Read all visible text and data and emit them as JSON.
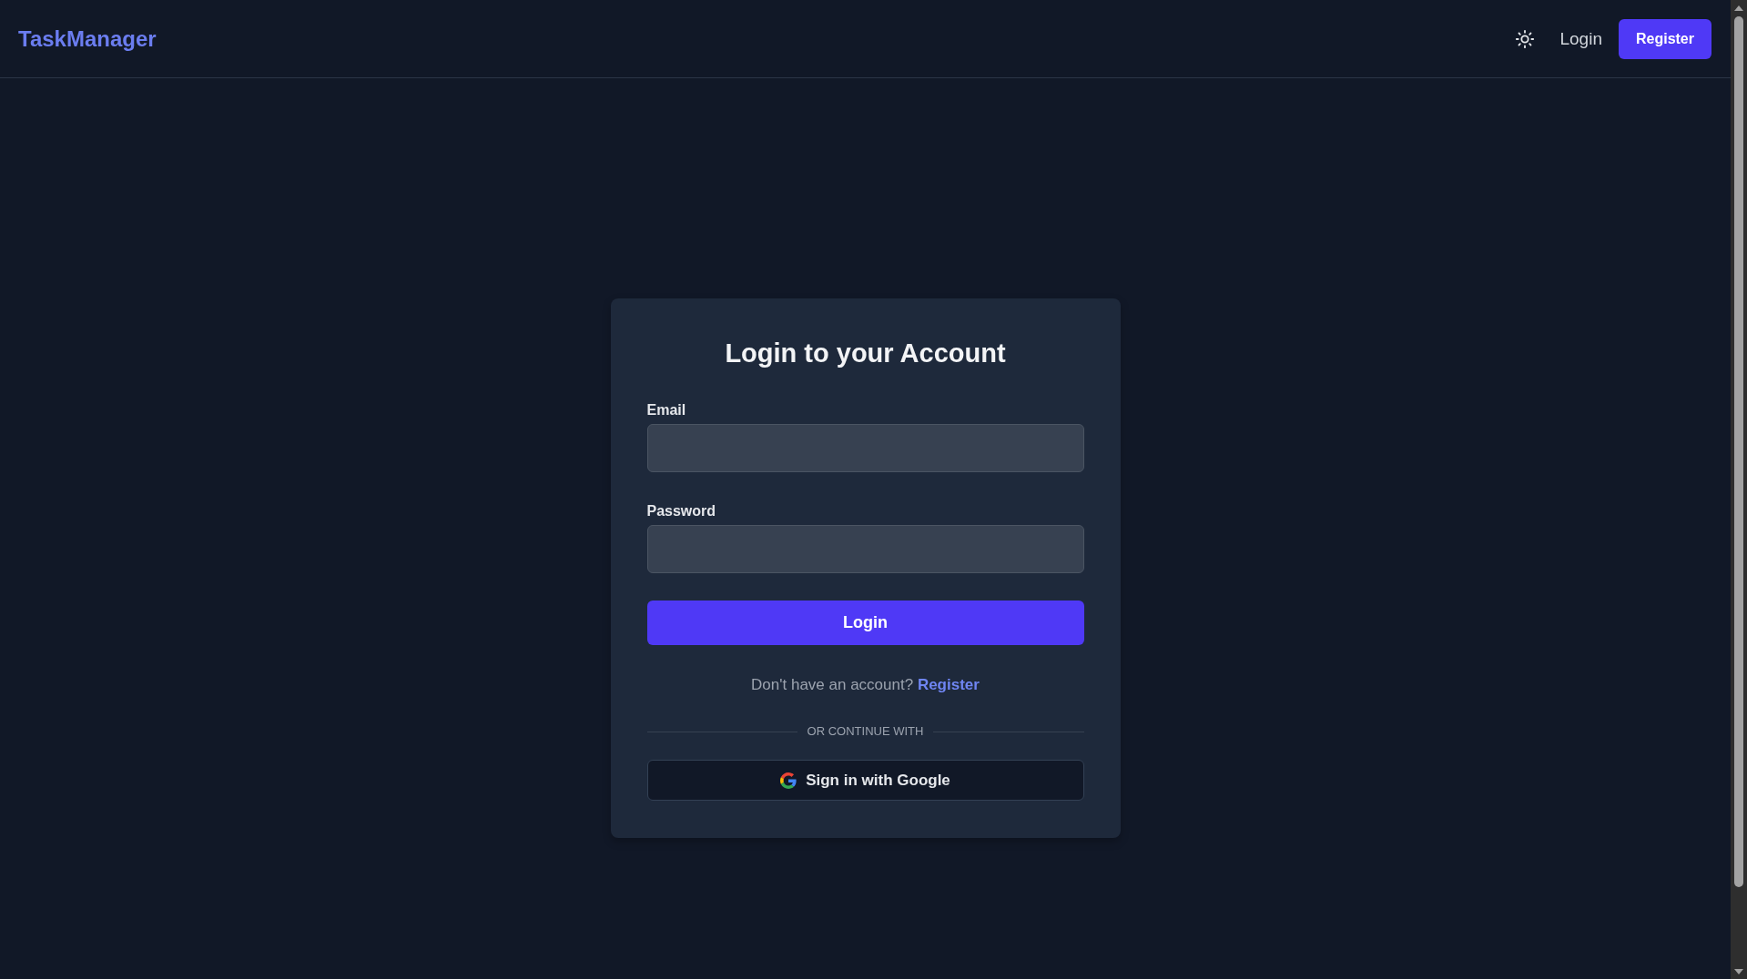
{
  "header": {
    "logo": "TaskManager",
    "login_link": "Login",
    "register_button": "Register"
  },
  "login_card": {
    "title": "Login to your Account",
    "fields": [
      {
        "label": "Email"
      },
      {
        "label": "Password"
      }
    ],
    "submit_button": "Login",
    "signup_prompt": {
      "text": "Don't have an account?",
      "link": "Register"
    },
    "divider": "OR CONTINUE WITH",
    "google_button": "Sign in with Google"
  }
}
